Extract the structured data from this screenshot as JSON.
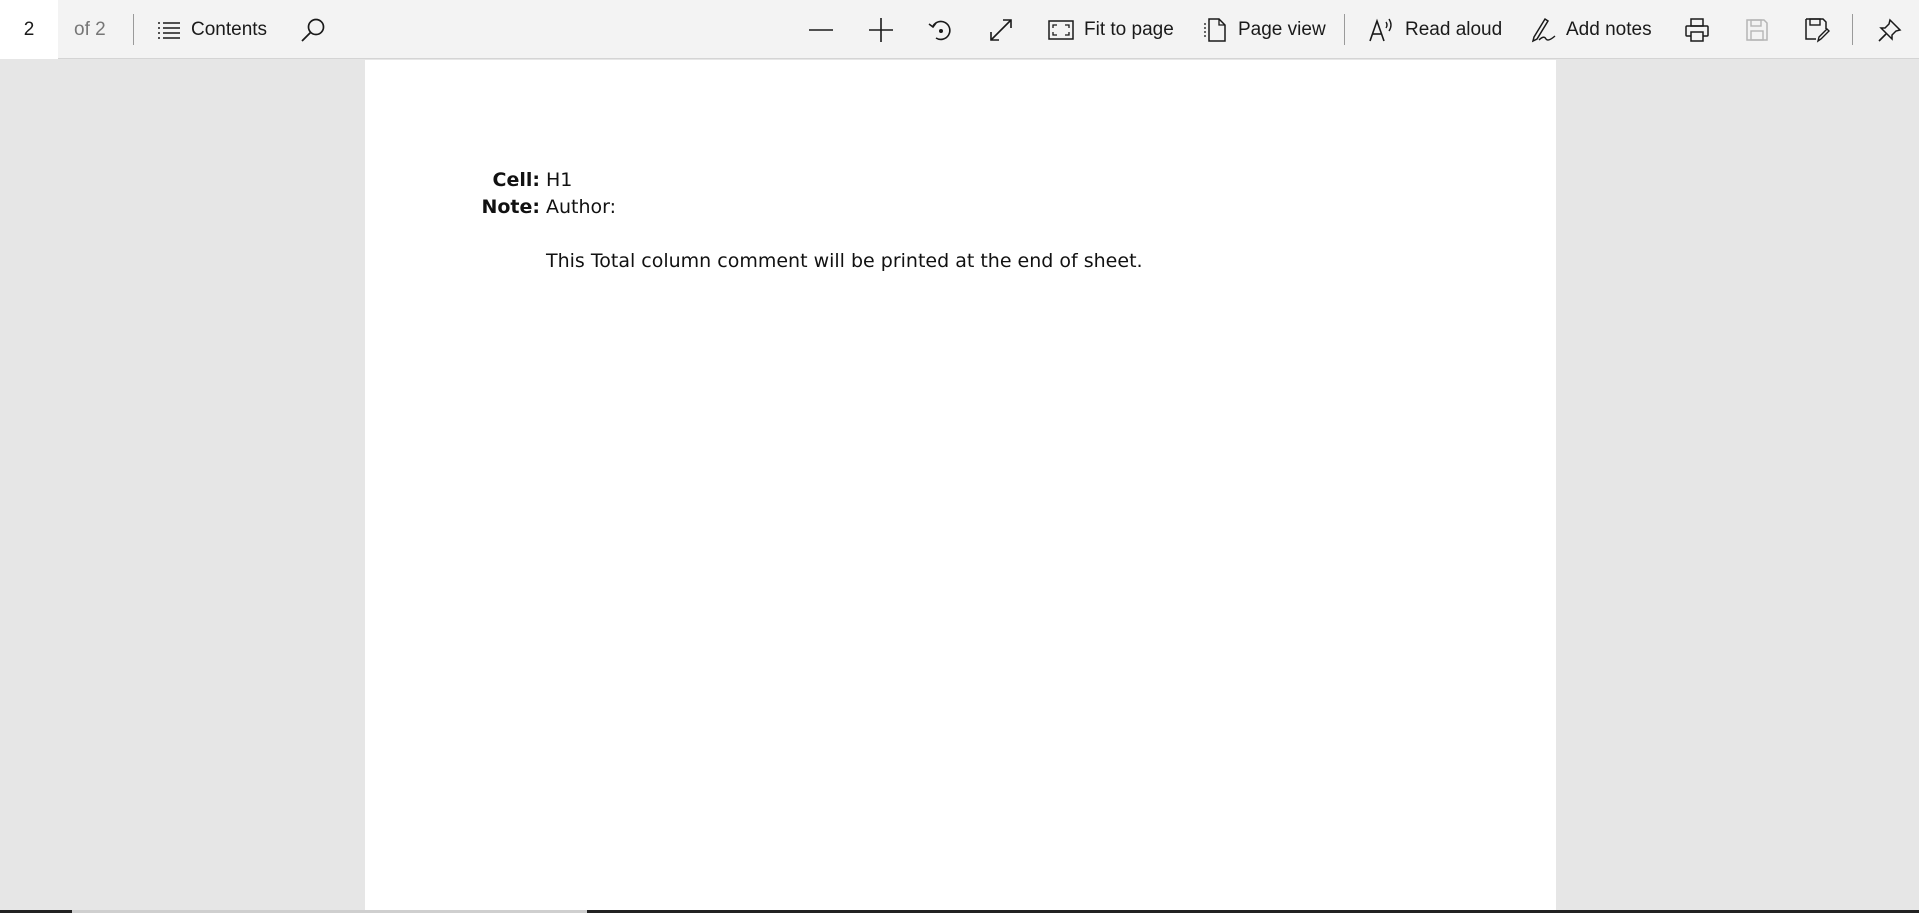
{
  "toolbar": {
    "page_current": "2",
    "page_of": "of 2",
    "contents_label": "Contents",
    "fit_to_page_label": "Fit to page",
    "page_view_label": "Page view",
    "read_aloud_label": "Read aloud",
    "add_notes_label": "Add notes",
    "icons": [
      "contents-icon",
      "search-icon",
      "zoom-out-icon",
      "zoom-in-icon",
      "rotate-icon",
      "fullscreen-icon",
      "fit-to-page-icon",
      "page-view-icon",
      "read-aloud-icon",
      "add-notes-icon",
      "print-icon",
      "save-icon",
      "save-as-icon",
      "pin-icon"
    ]
  },
  "document": {
    "cell_label": "Cell:",
    "cell_value": "H1",
    "note_label": "Note:",
    "note_author": "Author:",
    "note_text": "This Total column comment will be printed at the end of sheet."
  }
}
